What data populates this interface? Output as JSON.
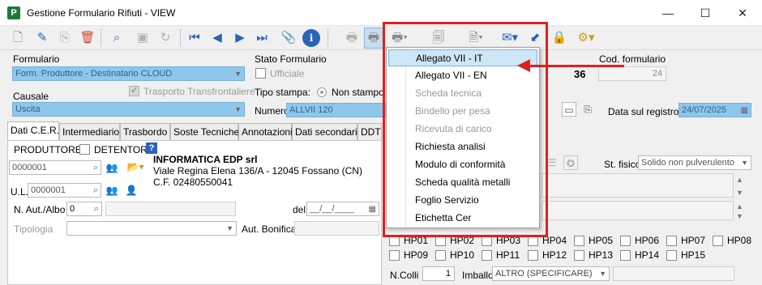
{
  "window": {
    "app_icon": "P",
    "title": "Gestione Formulario Rifiuti - VIEW",
    "minimize": "—",
    "maximize": "☐",
    "close": "✕"
  },
  "toolbar_icons": [
    "new-document-icon",
    "edit-pencil-icon",
    "copy-icon",
    "delete-icon",
    "search-icon",
    "save-icon",
    "refresh-icon",
    "first-record-icon",
    "previous-record-icon",
    "next-record-icon",
    "last-record-icon",
    "attachment-icon",
    "info-icon",
    "print-icon",
    "print-preview-icon",
    "print-menu-icon",
    "transport-document-icon",
    "document-menu-icon",
    "email-icon",
    "send-arrow-icon",
    "lock-icon",
    "settings-icon"
  ],
  "form": {
    "formulario_label": "Formulario",
    "formulario_value": "Form. Produttore - Destinatario CLOUD",
    "stato_label": "Stato Formulario",
    "ufficiale_label": "Ufficiale",
    "causale_label": "Causale",
    "causale_value": "Uscita",
    "trasporto_label": "Trasporto Transfrontaliere",
    "tipo_stampa_label": "Tipo stampa:",
    "non_stampo_label": "Non stampo",
    "numero_label": "Numero",
    "numero_value": "ALLVII 120",
    "count_value": "36",
    "cod_formulario_label": "Cod. formulario",
    "cod_formulario_value": "24",
    "data_registro_label": "Data sul registro",
    "data_registro_value": "24/07/2025"
  },
  "tabs": [
    "Dati C.E.R.",
    "Intermediario",
    "Trasbordo",
    "Soste Tecniche",
    "Annotazioni",
    "Dati secondari",
    "DDT"
  ],
  "panel": {
    "produttore_label": "PRODUTTORE",
    "detentore_label": "DETENTORE",
    "help_label": "?",
    "code_value": "0000001",
    "ul_label": "U.L.",
    "ul_value": "0000001",
    "company_name": "INFORMATICA EDP srl",
    "company_address": "Viale Regina Elena 136/A - 12045 Fossano (CN)",
    "company_cf": "C.F. 02480550041",
    "n_aut_label": "N. Aut./Albo",
    "n_aut_value": "0",
    "del_label": "del",
    "del_value": "__/__/____",
    "tipologia_label": "Tipologia",
    "aut_bonifica_label": "Aut. Bonifica"
  },
  "right_panel": {
    "st_fisico_label": "St. fisico",
    "st_fisico_value": "Solido non pulverulento",
    "hp_row1": [
      "HP01",
      "HP02",
      "HP03",
      "HP04",
      "HP05",
      "HP06",
      "HP07",
      "HP08"
    ],
    "hp_row2": [
      "HP09",
      "HP10",
      "HP11",
      "HP12",
      "HP13",
      "HP14",
      "HP15"
    ],
    "ncolli_label": "N.Colli",
    "ncolli_value": "1",
    "imballo_label": "Imballo",
    "imballo_value": "ALTRO (SPECIFICARE)"
  },
  "print_menu": {
    "items": [
      {
        "label": "Allegato VII - IT",
        "state": "selected"
      },
      {
        "label": "Allegato VII - EN",
        "state": "enabled"
      },
      {
        "label": "Scheda tecnica",
        "state": "disabled"
      },
      {
        "label": "Bindello per pesa",
        "state": "disabled"
      },
      {
        "label": "Ricevuta di carico",
        "state": "disabled"
      },
      {
        "label": "Richiesta analisi",
        "state": "enabled"
      },
      {
        "label": "Modulo di conformità",
        "state": "enabled"
      },
      {
        "label": "Scheda qualità metalli",
        "state": "enabled"
      },
      {
        "label": "Foglio Servizio",
        "state": "enabled"
      },
      {
        "label": "Etichetta Cer",
        "state": "enabled"
      }
    ]
  },
  "colors": {
    "highlight_red": "#e02020",
    "field_blue": "#8ec7ec",
    "menu_selected": "#cfe6f7"
  }
}
